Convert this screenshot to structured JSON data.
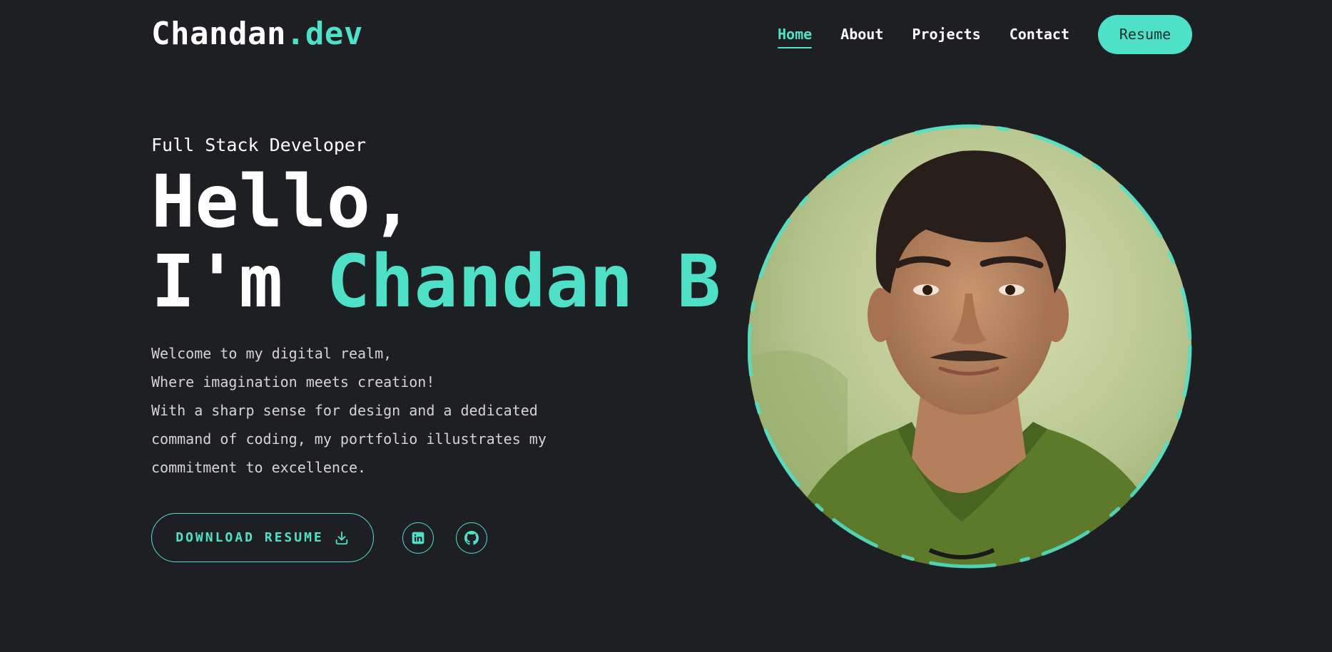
{
  "brand": {
    "name": "Chandan",
    "suffix": ".dev"
  },
  "nav": {
    "items": [
      {
        "label": "Home",
        "active": true
      },
      {
        "label": "About",
        "active": false
      },
      {
        "label": "Projects",
        "active": false
      },
      {
        "label": "Contact",
        "active": false
      }
    ],
    "resume_label": "Resume"
  },
  "hero": {
    "role": "Full Stack Developer",
    "greeting": "Hello,",
    "intro_prefix": "I'm ",
    "name": "Chandan B",
    "description": [
      "Welcome to my digital realm,",
      "Where imagination meets creation!",
      "With a sharp sense for design and a dedicated",
      "command of coding, my portfolio illustrates my",
      "commitment to excellence."
    ],
    "download_label": "DOWNLOAD RESUME"
  },
  "social": [
    {
      "icon": "linkedin-icon"
    },
    {
      "icon": "github-icon"
    }
  ],
  "colors": {
    "accent": "#4fe0c8",
    "background": "#1e1f23",
    "text": "#ffffff",
    "muted_text": "#d4d4d4"
  }
}
